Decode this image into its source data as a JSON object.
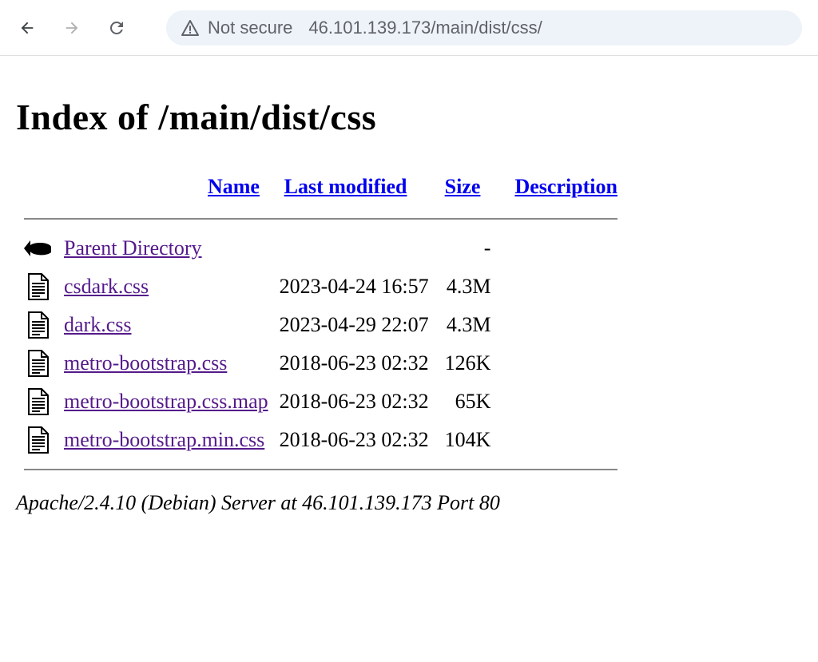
{
  "browser": {
    "not_secure_label": "Not secure",
    "url": "46.101.139.173/main/dist/css/"
  },
  "page": {
    "title": "Index of /main/dist/css",
    "columns": {
      "name": "Name",
      "last_modified": "Last modified",
      "size": "Size",
      "description": "Description"
    },
    "entries": [
      {
        "icon": "back",
        "name": "Parent Directory",
        "last_modified": "",
        "size": "-",
        "description": ""
      },
      {
        "icon": "text",
        "name": "csdark.css",
        "last_modified": "2023-04-24 16:57",
        "size": "4.3M",
        "description": ""
      },
      {
        "icon": "text",
        "name": "dark.css",
        "last_modified": "2023-04-29 22:07",
        "size": "4.3M",
        "description": ""
      },
      {
        "icon": "text",
        "name": "metro-bootstrap.css",
        "last_modified": "2018-06-23 02:32",
        "size": "126K",
        "description": ""
      },
      {
        "icon": "text",
        "name": "metro-bootstrap.css.map",
        "last_modified": "2018-06-23 02:32",
        "size": "65K",
        "description": ""
      },
      {
        "icon": "text",
        "name": "metro-bootstrap.min.css",
        "last_modified": "2018-06-23 02:32",
        "size": "104K",
        "description": ""
      }
    ],
    "footer": "Apache/2.4.10 (Debian) Server at 46.101.139.173 Port 80"
  }
}
